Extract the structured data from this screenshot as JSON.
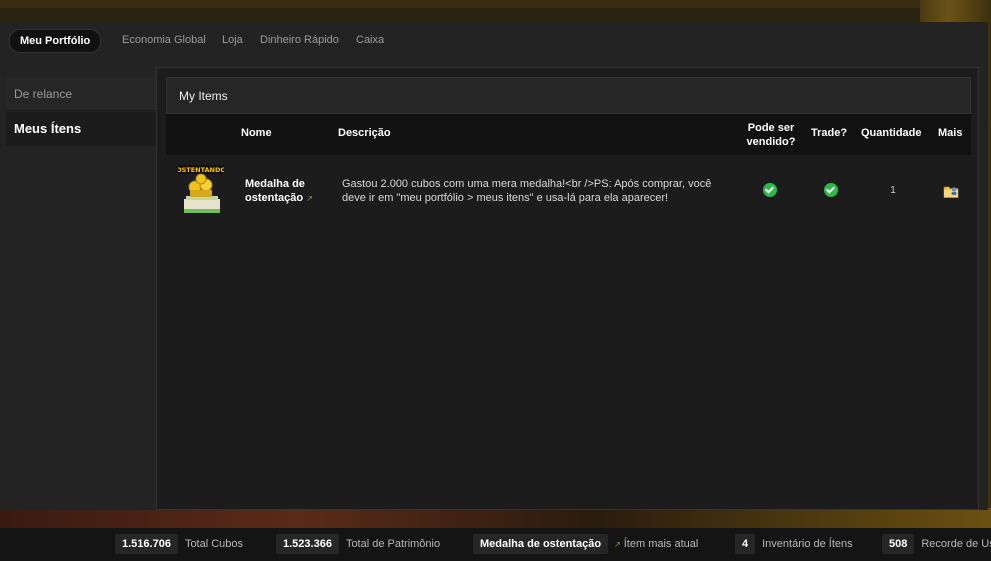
{
  "nav": {
    "items": [
      "Meu Portfólio",
      "Economia Global",
      "Loja",
      "Dinheiro Rápido",
      "Caixa"
    ]
  },
  "sidebar": {
    "items": [
      "De relance",
      "Meus Ítens"
    ]
  },
  "panel": {
    "title": "My Items",
    "columns": {
      "name": "Nome",
      "description": "Descrição",
      "sellable": "Pode ser vendido?",
      "trade": "Trade?",
      "quantity": "Quantidade",
      "more": "Mais"
    },
    "rows": [
      {
        "icon": "medal-ostentando-icon",
        "badge_text": "OSTENTANDO",
        "name": "Medalha de ostentação",
        "external_icon": "external-link-icon",
        "description": "Gastou 2.000 cubos com uma mera medalha!<br />PS: Após comprar, você deve ir em \"meu portfólio > meus itens\" e usa-lá para ela aparecer!",
        "sellable_icon": "check-icon",
        "trade_icon": "check-icon",
        "quantity": "1",
        "more_icon": "folder-user-icon"
      }
    ]
  },
  "footer": {
    "stats": [
      {
        "value": "1.516.706",
        "label": "Total Cubos"
      },
      {
        "value": "1.523.366",
        "label": "Total de Patrimônio"
      },
      {
        "value": "Medalha de ostentação",
        "label": "Ítem mais atual"
      },
      {
        "value": "4",
        "label": "Inventário de Ítens"
      },
      {
        "value": "508",
        "label": "Recorde de Us"
      }
    ]
  },
  "colors": {
    "accent_green": "#2fb84a",
    "medal_gold": "#f2c21a",
    "panel_bg": "#1c1c1c"
  }
}
